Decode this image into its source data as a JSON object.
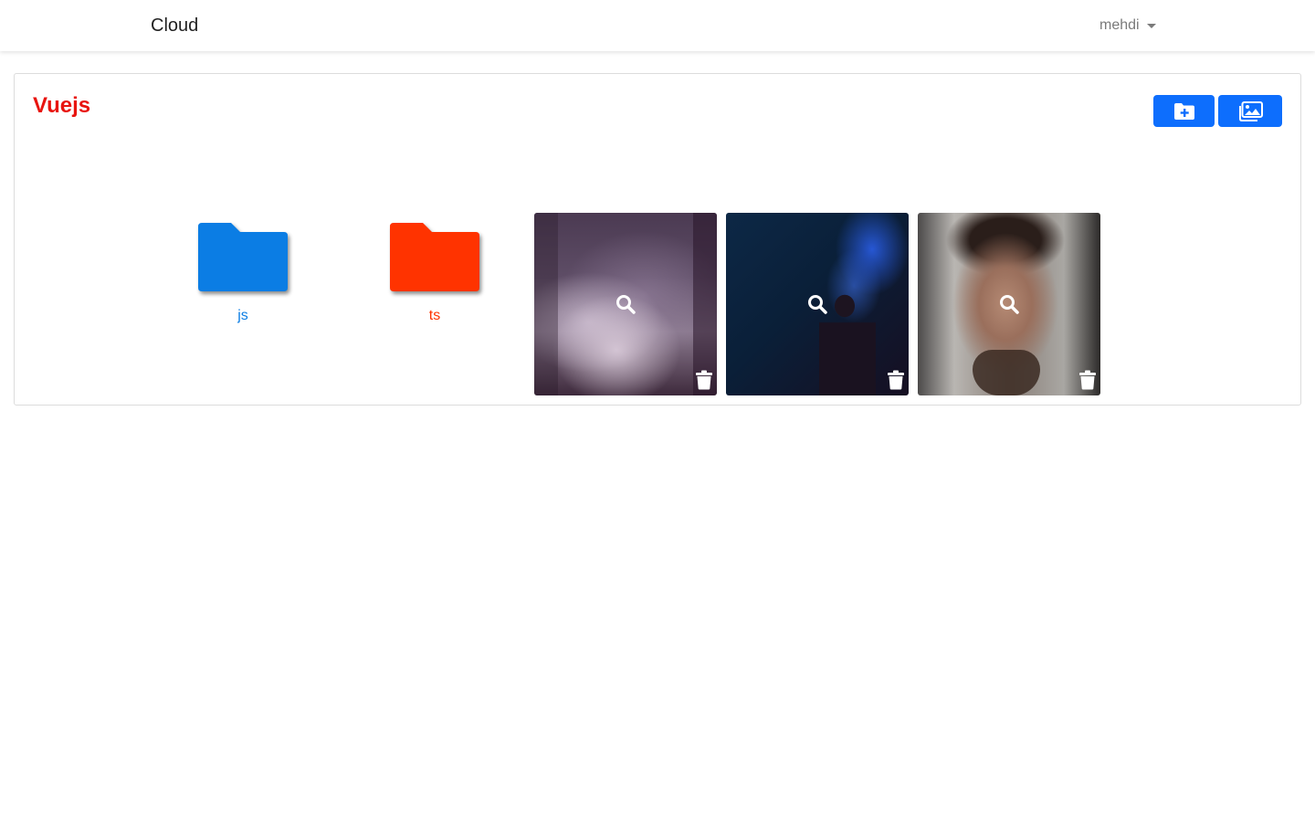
{
  "navbar": {
    "brand": "Cloud",
    "user": "mehdi"
  },
  "folder_view": {
    "title": "Vuejs",
    "actions": {
      "new_folder_icon": "folder-plus-icon",
      "upload_images_icon": "images-icon"
    },
    "folders": [
      {
        "name": "js",
        "color": "#0b7de4"
      },
      {
        "name": "ts",
        "color": "#ff3300"
      }
    ],
    "images": [
      {
        "overlay_icon": "search-icon",
        "delete_icon": "trash-icon"
      },
      {
        "overlay_icon": "search-icon",
        "delete_icon": "trash-icon"
      },
      {
        "overlay_icon": "search-icon",
        "delete_icon": "trash-icon"
      }
    ]
  },
  "colors": {
    "title": "#e8140f",
    "primary": "#0d6efd"
  }
}
